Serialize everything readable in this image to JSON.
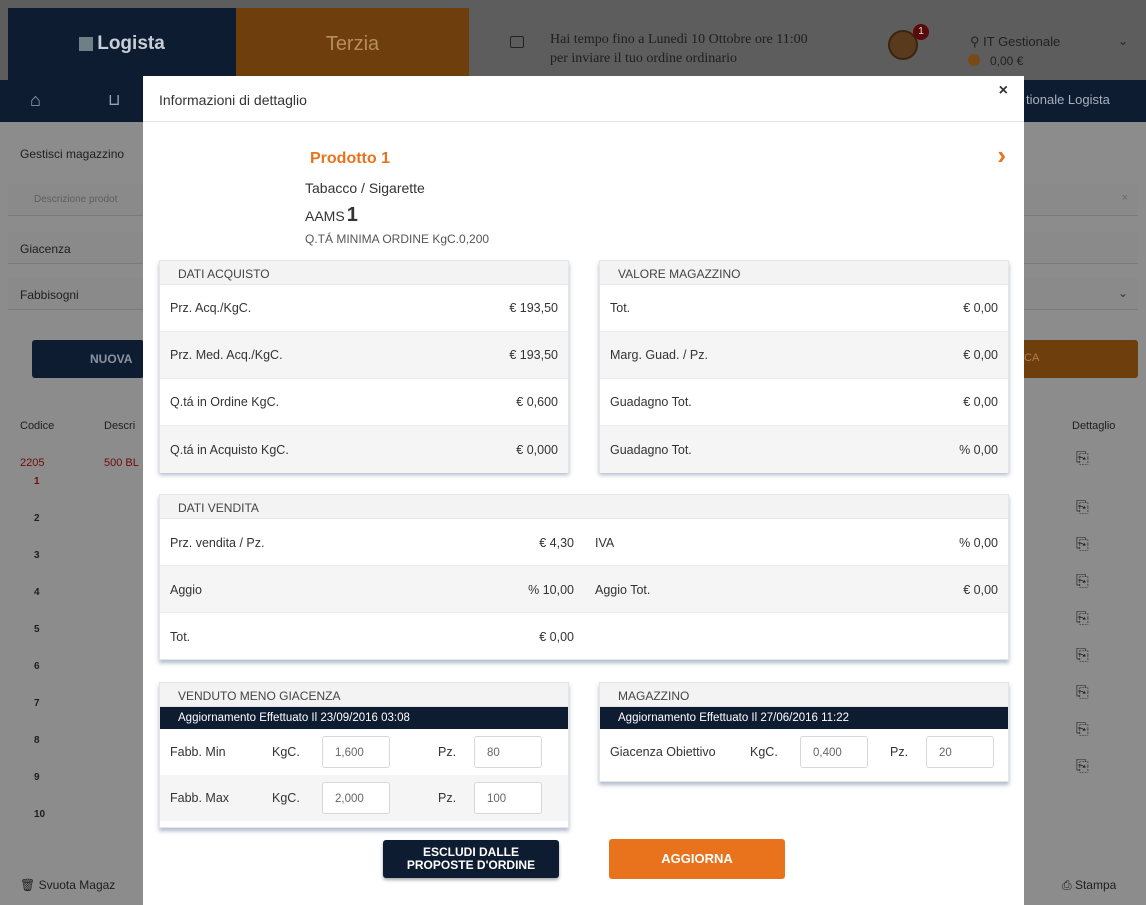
{
  "header": {
    "logo_left": "Logista",
    "logo_right": "Terzia",
    "message": "Hai tempo fino a Lunedì 10 Ottobre ore 11:00",
    "message_line2": "per inviare il tuo ordine ordinario",
    "notification_count": "1",
    "user": "IT Gestionale",
    "balance": "0,00 €"
  },
  "nav": {
    "right_label": "tionale Logista"
  },
  "background": {
    "section_title": "Gestisci magazzino",
    "search_placeholder": "Descrizione prodot",
    "filter1": "Giacenza",
    "filter2": "Fabbisogni",
    "btn_new": "NUOVA",
    "btn_right": "CA",
    "col_codice": "Codice",
    "col_descr": "Descri",
    "col_dettaglio": "Dettaglio",
    "row1_code": "2205",
    "row1_desc": "500 BL",
    "rows": [
      "1",
      "2",
      "3",
      "4",
      "5",
      "6",
      "7",
      "8",
      "9",
      "10"
    ],
    "footer_left": "Svuota Magaz",
    "footer_right": "Stampa"
  },
  "modal": {
    "title": "Informazioni di dettaglio",
    "close": "×",
    "product_name": "Prodotto 1",
    "category": "Tabacco / Sigarette",
    "aams_label": "AAMS",
    "aams_value": "1",
    "min_order": "Q.TÁ MINIMA ORDINE KgC.0,200",
    "dati_acquisto": {
      "title": "DATI ACQUISTO",
      "rows": [
        {
          "label": "Prz. Acq./KgC.",
          "value": "€ 193,50"
        },
        {
          "label": "Prz. Med. Acq./KgC.",
          "value": "€ 193,50"
        },
        {
          "label": "Q.tá in Ordine KgC.",
          "value": "€ 0,600"
        },
        {
          "label": "Q.tá in Acquisto KgC.",
          "value": "€ 0,000"
        }
      ]
    },
    "valore_magazzino": {
      "title": "VALORE MAGAZZINO",
      "rows": [
        {
          "label": "Tot.",
          "value": "€ 0,00"
        },
        {
          "label": "Marg. Guad. / Pz.",
          "value": "€ 0,00"
        },
        {
          "label": "Guadagno Tot.",
          "value": "€ 0,00"
        },
        {
          "label": "Guadagno Tot.",
          "value": "% 0,00"
        }
      ]
    },
    "dati_vendita": {
      "title": "DATI VENDITA",
      "rows": [
        {
          "l1": "Prz. vendita / Pz.",
          "v1": "€ 4,30",
          "l2": "IVA",
          "v2": "% 0,00"
        },
        {
          "l1": "Aggio",
          "v1": "% 10,00",
          "l2": "Aggio Tot.",
          "v2": "€ 0,00"
        },
        {
          "l1": "Tot.",
          "v1": "€ 0,00",
          "l2": "",
          "v2": ""
        }
      ]
    },
    "venduto": {
      "title": "VENDUTO MENO GIACENZA",
      "update": "Aggiornamento Effettuato Il 23/09/2016 03:08",
      "min_label": "Fabb. Min",
      "max_label": "Fabb. Max",
      "unit_kgc": "KgC.",
      "unit_pz": "Pz.",
      "min_kgc": "1,600",
      "min_pz": "80",
      "max_kgc": "2,000",
      "max_pz": "100"
    },
    "magazzino": {
      "title": "MAGAZZINO",
      "update": "Aggiornamento Effettuato Il 27/06/2016 11:22",
      "label": "Giacenza Obiettivo",
      "unit_kgc": "KgC.",
      "unit_pz": "Pz.",
      "kgc": "0,400",
      "pz": "20"
    },
    "btn_escludi_line1": "ESCLUDI DALLE",
    "btn_escludi_line2": "PROPOSTE D'ORDINE",
    "btn_aggiorna": "AGGIORNA"
  }
}
